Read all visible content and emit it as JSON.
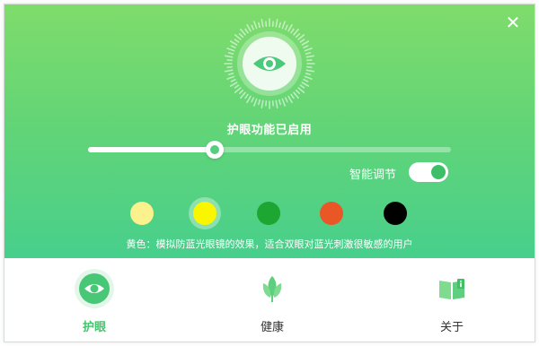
{
  "window": {
    "close_icon": "close-icon",
    "close_glyph": "✕"
  },
  "hero": {
    "status_text": "护眼功能已启用",
    "eye_brightness_level": 0.35,
    "smart_adjust_label": "智能调节",
    "smart_adjust_enabled": true,
    "swatches": [
      {
        "name": "pale-yellow",
        "color": "#fbf28e",
        "selected": false
      },
      {
        "name": "yellow",
        "color": "#f9f600",
        "selected": true
      },
      {
        "name": "green",
        "color": "#1ea632",
        "selected": false
      },
      {
        "name": "orange",
        "color": "#ea5727",
        "selected": false
      },
      {
        "name": "black",
        "color": "#000000",
        "selected": false
      }
    ],
    "description": "黄色：模拟防蓝光眼镜的效果，适合双眼对蓝光刺激很敏感的用户"
  },
  "nav": {
    "items": [
      {
        "label": "护眼",
        "icon": "eye-icon",
        "active": true
      },
      {
        "label": "健康",
        "icon": "leaf-icon",
        "active": false
      },
      {
        "label": "关于",
        "icon": "info-book-icon",
        "active": false
      }
    ]
  },
  "colors": {
    "accent": "#3fc56a",
    "hero_top": "#7fdc6b",
    "hero_bottom": "#47cf8c"
  }
}
